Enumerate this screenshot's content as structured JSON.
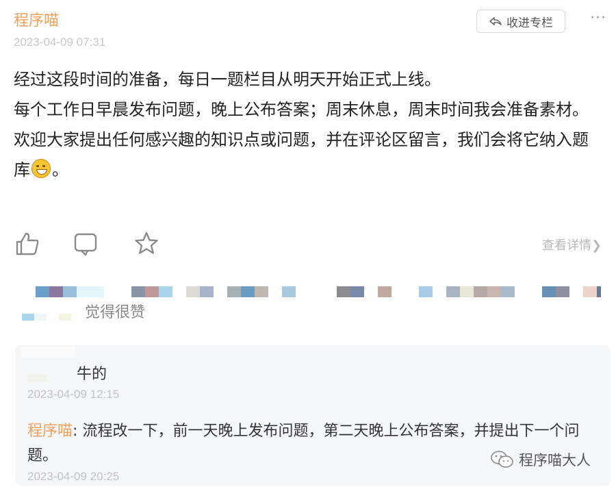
{
  "post": {
    "author": "程序喵",
    "time": "2023-04-09 07:31",
    "collect_label": "收进专栏",
    "more_label": "···",
    "paragraphs": [
      "经过这段时间的准备，每日一题栏目从明天开始正式上线。",
      "每个工作日早晨发布问题，晚上公布答案；周末休息，周末时间我会准备素材。",
      "欢迎大家提出任何感兴趣的知识点或问题，并在评论区留言，我们会将它纳入题库",
      "。"
    ],
    "emoji": "grinning-sweat-emoji",
    "details_label": "查看详情"
  },
  "likes": {
    "text": "觉得很赞"
  },
  "comment": {
    "text": "牛的",
    "time": "2023-04-09 12:15",
    "reply": {
      "author": "程序喵",
      "separator": ":",
      "text": "流程改一下，前一天晚上发布问题，第二天晚上公布答案，并提出下一个问题。",
      "time": "2023-04-09 20:25"
    }
  },
  "watermark": {
    "text": "程序喵大人"
  },
  "colors": {
    "author": "#f0a05a",
    "meta": "#c8c8c8",
    "comment_bg": "#f6f7f9"
  }
}
